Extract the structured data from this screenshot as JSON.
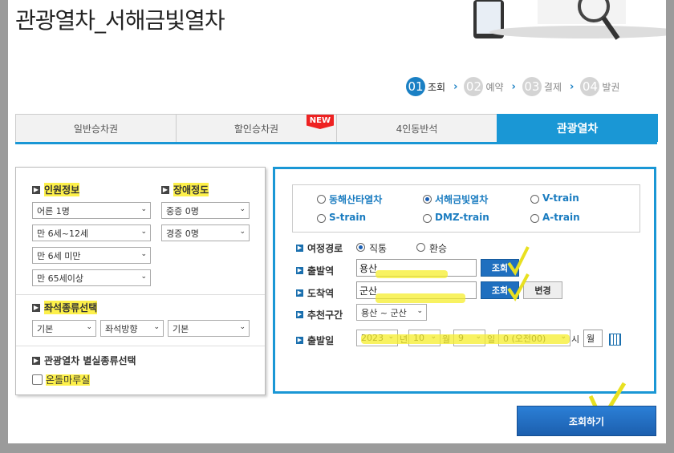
{
  "page": {
    "title": "관광열차_서해금빛열차"
  },
  "steps": [
    {
      "num": "01",
      "label": "조회",
      "active": true
    },
    {
      "num": "02",
      "label": "예약",
      "active": false
    },
    {
      "num": "03",
      "label": "결제",
      "active": false
    },
    {
      "num": "04",
      "label": "발권",
      "active": false
    }
  ],
  "tabs": [
    {
      "label": "일반승차권"
    },
    {
      "label": "할인승차권",
      "badge": "NEW"
    },
    {
      "label": "4인동반석"
    },
    {
      "label": "관광열차",
      "active": true
    }
  ],
  "passengers": {
    "title": "인원정보",
    "adult": "어른 1명",
    "child": "만 6세~12세",
    "infant": "만 6세 미만",
    "senior": "만 65세이상"
  },
  "disability": {
    "title": "장애정도",
    "severe": "중증 0명",
    "mild": "경증 0명"
  },
  "seat_type": {
    "title": "좌석종류선택",
    "option1": "기본",
    "direction": "좌석방향",
    "option2": "기본"
  },
  "special_seat": {
    "title": "관광열차 별실종류선택",
    "ondol_label": "온돌마루실"
  },
  "train_types": [
    {
      "label": "동해산타열차",
      "selected": false
    },
    {
      "label": "서해금빛열차",
      "selected": true
    },
    {
      "label": "V-train",
      "selected": false
    },
    {
      "label": "S-train",
      "selected": false
    },
    {
      "label": "DMZ-train",
      "selected": false
    },
    {
      "label": "A-train",
      "selected": false
    }
  ],
  "route": {
    "label": "여정경로",
    "direct": "직통",
    "transfer": "환승",
    "selected": "직통"
  },
  "departure": {
    "label": "출발역",
    "value": "용산",
    "button": "조회"
  },
  "arrival": {
    "label": "도착역",
    "value": "군산",
    "button": "조회",
    "swap_button": "변경"
  },
  "recommended": {
    "label": "추천구간",
    "value": "용산 ~ 군산"
  },
  "date": {
    "label": "출발일",
    "year": "2023",
    "year_unit": "년",
    "month": "10",
    "month_unit": "월",
    "day": "9",
    "day_unit": "일",
    "hour": "0 (오전00)",
    "hour_unit": "시",
    "weekday": "월"
  },
  "submit": {
    "label": "조회하기"
  },
  "colors": {
    "accent": "#1a97d5",
    "highlight": "#fdf04a",
    "new_badge": "#e22222"
  }
}
